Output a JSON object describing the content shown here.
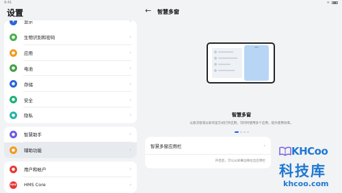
{
  "settings": {
    "title": "设置"
  },
  "sidebar": {
    "top_partial_label": "显示",
    "group1": [
      {
        "label": "生物识别和密码",
        "icon": "fingerprint-icon",
        "color": "#4caf50"
      },
      {
        "label": "应用",
        "icon": "apps-icon",
        "color": "#f39a1e"
      },
      {
        "label": "电池",
        "icon": "battery-icon",
        "color": "#43a047"
      },
      {
        "label": "存储",
        "icon": "storage-icon",
        "color": "#2a66d9"
      },
      {
        "label": "安全",
        "icon": "shield-icon",
        "color": "#20b07a"
      },
      {
        "label": "隐私",
        "icon": "privacy-icon",
        "color": "#2bb3a3"
      }
    ],
    "group2": [
      {
        "label": "智慧助手",
        "icon": "assistant-icon",
        "color": "#6d5be3"
      },
      {
        "label": "辅助功能",
        "icon": "accessibility-icon",
        "color": "#f39a1e"
      }
    ],
    "group3": [
      {
        "label": "用户和帐户",
        "icon": "user-icon",
        "color": "#e53935"
      },
      {
        "label": "HMS Core",
        "icon": "hms-icon",
        "color": "#e53935",
        "icon_text": "HMS"
      }
    ]
  },
  "detail": {
    "title": "智慧多窗",
    "feature_title": "智慧多窗",
    "feature_desc": "以悬浮窗或分屏浏览方式打开应用，可同时使用多个应用，提升使用效率。",
    "carousel": {
      "pages": 4,
      "active": 1
    },
    "app_setting_label": "智慧多窗应用栏",
    "app_setting_hint": "开启后，可以从屏幕边缘拉出应用栏"
  },
  "watermark": {
    "logo": "KHCoo",
    "name": "科技库",
    "url": "khcoo.com"
  }
}
